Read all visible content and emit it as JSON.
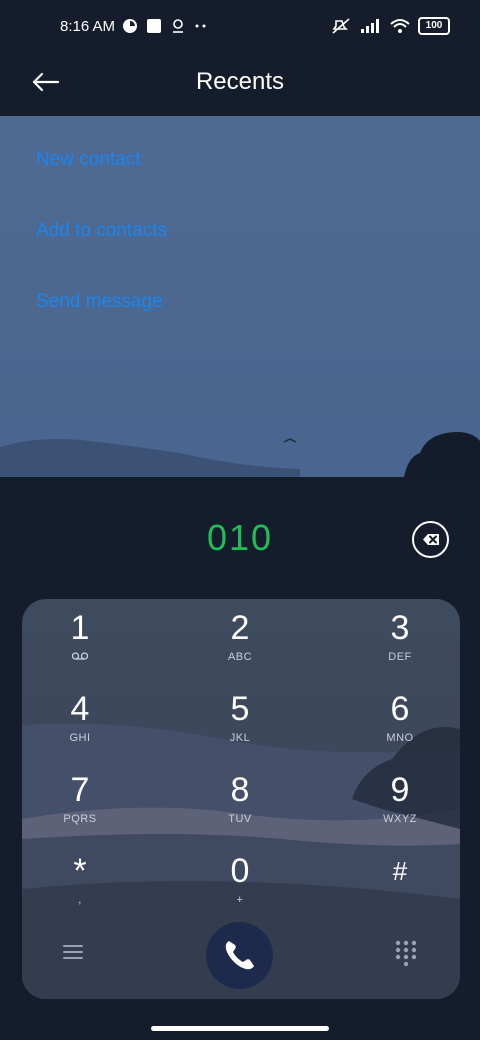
{
  "status": {
    "time": "8:16 AM",
    "battery": "100"
  },
  "header": {
    "title": "Recents"
  },
  "actions": [
    {
      "label": "New contact"
    },
    {
      "label": "Add to contacts"
    },
    {
      "label": "Send message"
    }
  ],
  "dialer": {
    "number": "010",
    "keys": [
      {
        "digit": "1",
        "letters": ""
      },
      {
        "digit": "2",
        "letters": "ABC"
      },
      {
        "digit": "3",
        "letters": "DEF"
      },
      {
        "digit": "4",
        "letters": "GHI"
      },
      {
        "digit": "5",
        "letters": "JKL"
      },
      {
        "digit": "6",
        "letters": "MNO"
      },
      {
        "digit": "7",
        "letters": "PQRS"
      },
      {
        "digit": "8",
        "letters": "TUV"
      },
      {
        "digit": "9",
        "letters": "WXYZ"
      },
      {
        "digit": "*",
        "letters": ","
      },
      {
        "digit": "0",
        "letters": "+"
      },
      {
        "digit": "#",
        "letters": ""
      }
    ]
  },
  "icons": {
    "back": "arrow-left-icon",
    "backspace": "backspace-icon",
    "voicemail": "voicemail-icon",
    "call": "phone-icon",
    "menu": "menu-icon",
    "dialpad": "dialpad-grid-icon"
  },
  "colors": {
    "accent_blue": "#1a86ef",
    "number_green": "#1fbe57",
    "call_button": "#1d2a4c",
    "background": "#151d2c"
  }
}
